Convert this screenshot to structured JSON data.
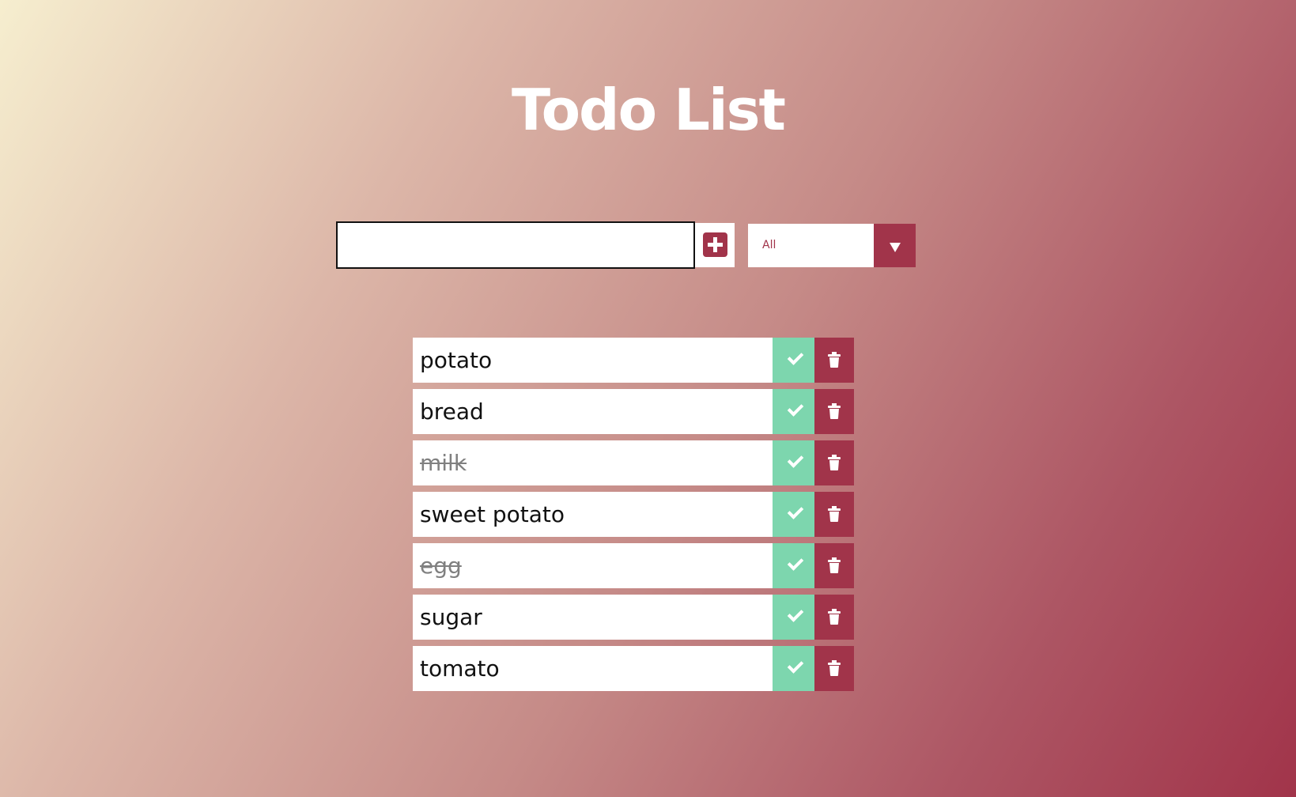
{
  "app": {
    "title": "Todo List"
  },
  "form": {
    "input_value": "",
    "input_placeholder": "",
    "add_icon": "plus-square-icon",
    "filter": {
      "selected": "All"
    }
  },
  "todos": [
    {
      "text": "potato",
      "completed": false
    },
    {
      "text": "bread",
      "completed": false
    },
    {
      "text": "milk",
      "completed": true
    },
    {
      "text": "sweet potato",
      "completed": false
    },
    {
      "text": "egg",
      "completed": true
    },
    {
      "text": "sugar",
      "completed": false
    },
    {
      "text": "tomato",
      "completed": false
    }
  ],
  "icons": {
    "complete": "check-icon",
    "delete": "trash-icon"
  },
  "colors": {
    "accent": "#a1344a",
    "complete": "#7dd6ae",
    "gradient_start": "#f6eecf",
    "gradient_end": "#a1344a"
  }
}
